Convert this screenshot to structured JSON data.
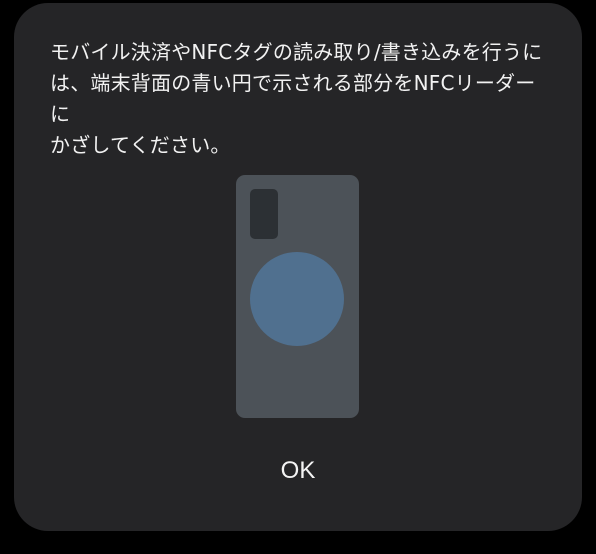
{
  "dialog": {
    "message": "モバイル決済やNFCタグの読み取り/書き込みを行うに\nは、端末背面の青い円で示される部分をNFCリーダーに\nかざしてください。",
    "ok_label": "OK"
  },
  "illustration": {
    "phone_color": "#4c5258",
    "camera_color": "#2c3034",
    "nfc_area_color": "#50708f"
  }
}
